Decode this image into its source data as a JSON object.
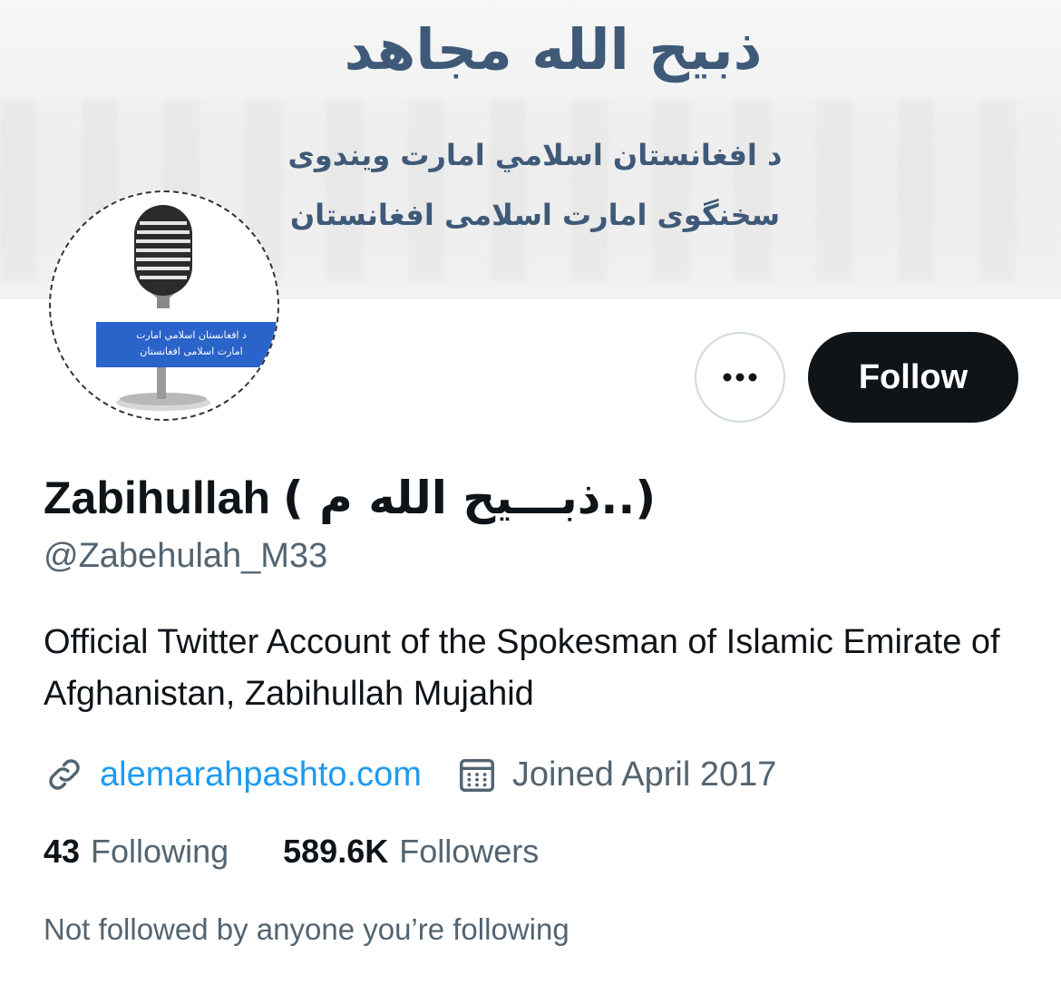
{
  "banner": {
    "title": "ذبیح الله مجاهد",
    "line1": "د افغانستان اسلامي امارت ویندوی",
    "line2": "سخنگوی امارت اسلامی افغانستان"
  },
  "avatar": {
    "label_line1": "د افغانستان اسلامي امارت",
    "label_line2": "امارت اسلامی افغانستان"
  },
  "actions": {
    "more_label": "•••",
    "follow_label": "Follow"
  },
  "profile": {
    "name_latin": "Zabihullah",
    "name_arabic": "(..ذبـــیح الله م )",
    "handle": "@Zabehulah_M33",
    "bio": "Official Twitter Account of the Spokesman of Islamic Emirate of Afghanistan, Zabihullah Mujahid",
    "website": "alemarahpashto.com",
    "joined": "Joined April 2017"
  },
  "stats": {
    "following_count": "43",
    "following_label": "Following",
    "followers_count": "589.6K",
    "followers_label": "Followers"
  },
  "followed_note": "Not followed by anyone you’re following",
  "colors": {
    "banner_text": "#3f5a78",
    "link": "#1d9bf0",
    "secondary_text": "#536471",
    "button_dark": "#0f1419"
  },
  "icons": [
    "link-icon",
    "calendar-icon",
    "microphone-icon",
    "more-icon"
  ]
}
